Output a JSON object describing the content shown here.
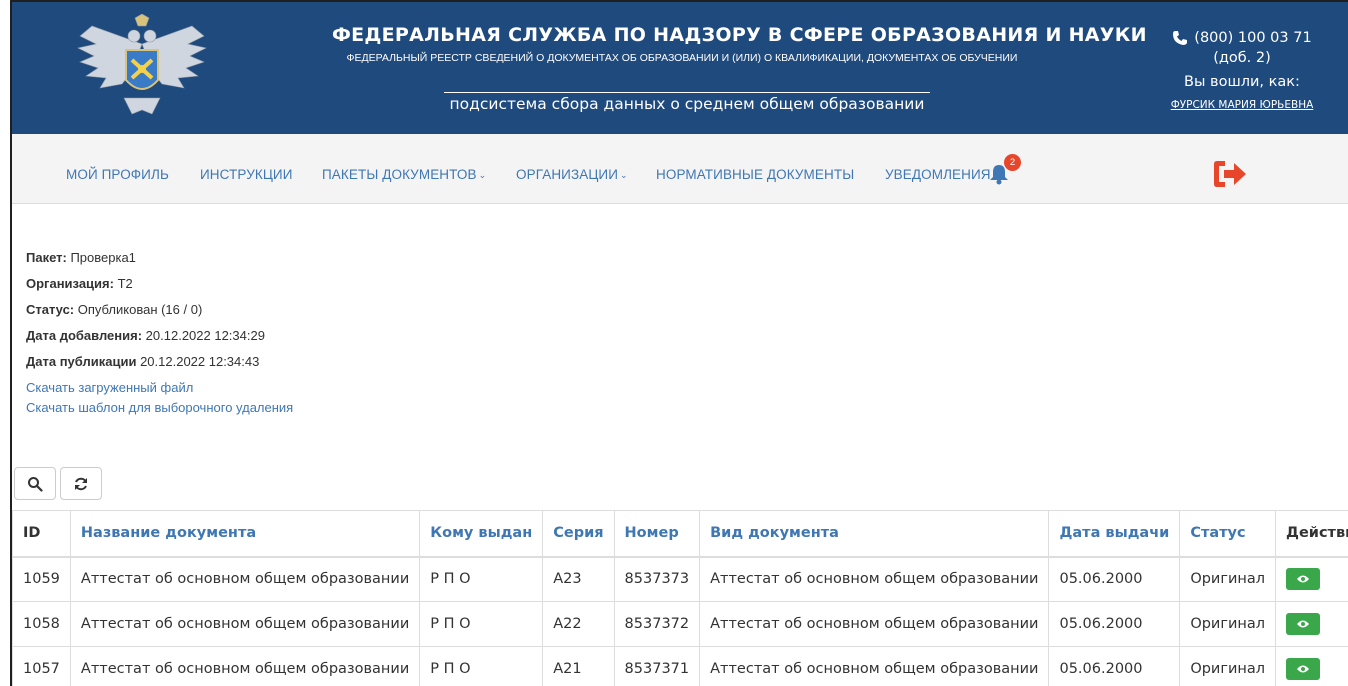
{
  "header": {
    "title": "ФЕДЕРАЛЬНАЯ СЛУЖБА ПО НАДЗОРУ В СФЕРЕ ОБРАЗОВАНИЯ И НАУКИ",
    "subtitle": "ФЕДЕРАЛЬНЫЙ РЕЕСТР СВЕДЕНИЙ О ДОКУМЕНТАХ ОБ ОБРАЗОВАНИИ И (ИЛИ) О КВАЛИФИКАЦИИ, ДОКУМЕНТАХ ОБ ОБУЧЕНИИ",
    "subsystem": "подсистема сбора данных о среднем общем образовании",
    "phone": "(800) 100 03 71",
    "phone_ext": "(доб. 2)",
    "logged_in_as": "Вы вошли, как:",
    "user_name": "ФУРСИК МАРИЯ ЮРЬЕВНА",
    "bg_color": "#1f4a7e"
  },
  "nav": {
    "items": [
      {
        "label": "МОЙ ПРОФИЛЬ"
      },
      {
        "label": "ИНСТРУКЦИИ"
      },
      {
        "label": "ПАКЕТЫ ДОКУМЕНТОВ"
      },
      {
        "label": "ОРГАНИЗАЦИИ"
      },
      {
        "label": "НОРМАТИВНЫЕ ДОКУМЕНТЫ"
      },
      {
        "label": "УВЕДОМЛЕНИЯ"
      }
    ],
    "notification_count": "2",
    "accent_color": "#3f77b4",
    "logout_color": "#e8462a"
  },
  "package": {
    "package_label": "Пакет:",
    "package_value": " Проверка1",
    "org_label": "Организация:",
    "org_value": " Т2",
    "status_label": "Статус:",
    "status_value": " Опубликован (16 / 0)",
    "added_label": "Дата добавления:",
    "added_value": " 20.12.2022 12:34:29",
    "published_label": "Дата публикации",
    "published_value": " 20.12.2022 12:34:43",
    "download_file": "Скачать загруженный файл",
    "download_template": "Скачать шаблон для выборочного удаления"
  },
  "toolbar": {
    "search_icon": "search-icon",
    "refresh_icon": "refresh-icon"
  },
  "table": {
    "columns": [
      "ID",
      "Название документа",
      "Кому выдан",
      "Серия",
      "Номер",
      "Вид документа",
      "Дата выдачи",
      "Статус",
      "Действия"
    ],
    "rows": [
      {
        "id": "1059",
        "name": "Аттестат об основном общем образовании",
        "to": "Р П О",
        "series": "А23",
        "number": "8537373",
        "type": "Аттестат об основном общем образовании",
        "date": "05.06.2000",
        "status": "Оригинал"
      },
      {
        "id": "1058",
        "name": "Аттестат об основном общем образовании",
        "to": "Р П О",
        "series": "А22",
        "number": "8537372",
        "type": "Аттестат об основном общем образовании",
        "date": "05.06.2000",
        "status": "Оригинал"
      },
      {
        "id": "1057",
        "name": "Аттестат об основном общем образовании",
        "to": "Р П О",
        "series": "А21",
        "number": "8537371",
        "type": "Аттестат об основном общем образовании",
        "date": "05.06.2000",
        "status": "Оригинал"
      }
    ],
    "action_color": "#3aa84a"
  }
}
